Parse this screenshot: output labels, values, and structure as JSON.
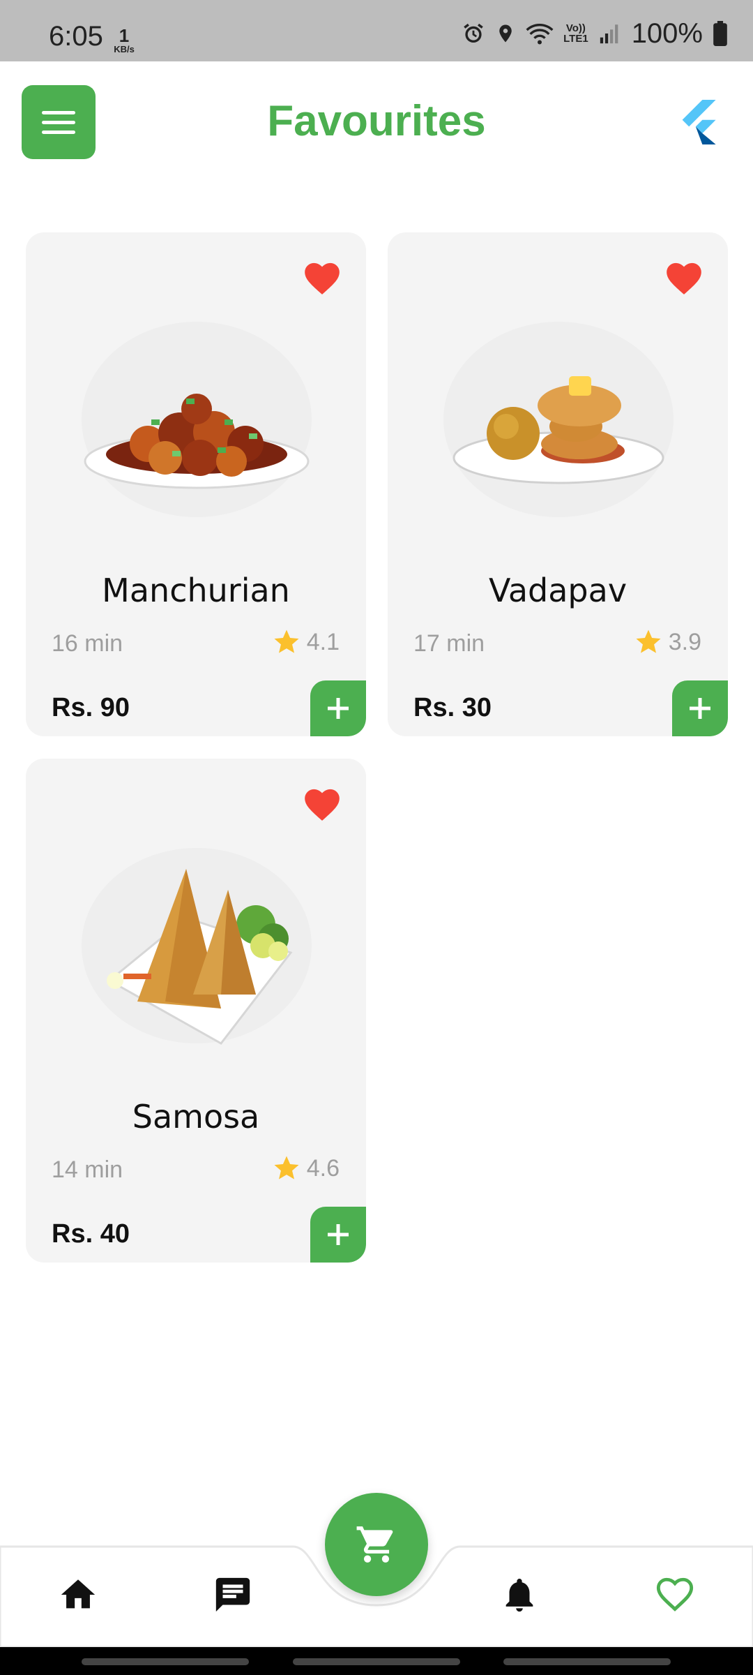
{
  "status_bar": {
    "time": "6:05",
    "speed_value": "1",
    "speed_unit": "KB/s",
    "battery": "100%",
    "icons": [
      "alarm-icon",
      "location-icon",
      "wifi-icon",
      "volte-icon",
      "signal-icon",
      "battery-icon"
    ],
    "volte_label": "Vo))",
    "lte_label": "LTE1"
  },
  "header": {
    "title": "Favourites",
    "menu_icon": "menu-icon",
    "logo": "flutter-logo"
  },
  "items": [
    {
      "name": "Manchurian",
      "time": "16 min",
      "rating": "4.1",
      "price": "Rs. 90",
      "favourite": true
    },
    {
      "name": "Vadapav",
      "time": "17 min",
      "rating": "3.9",
      "price": "Rs. 30",
      "favourite": true
    },
    {
      "name": "Samosa",
      "time": "14 min",
      "rating": "4.6",
      "price": "Rs. 40",
      "favourite": true
    }
  ],
  "bottom_nav": {
    "items": [
      "home-icon",
      "chat-icon",
      "cart-icon",
      "bell-icon",
      "heart-icon"
    ],
    "active": "heart-icon"
  },
  "colors": {
    "accent": "#4caf50",
    "heart": "#f44336",
    "star": "#fbc02d",
    "card_bg": "#f4f4f4",
    "muted_text": "#9e9e9e"
  }
}
